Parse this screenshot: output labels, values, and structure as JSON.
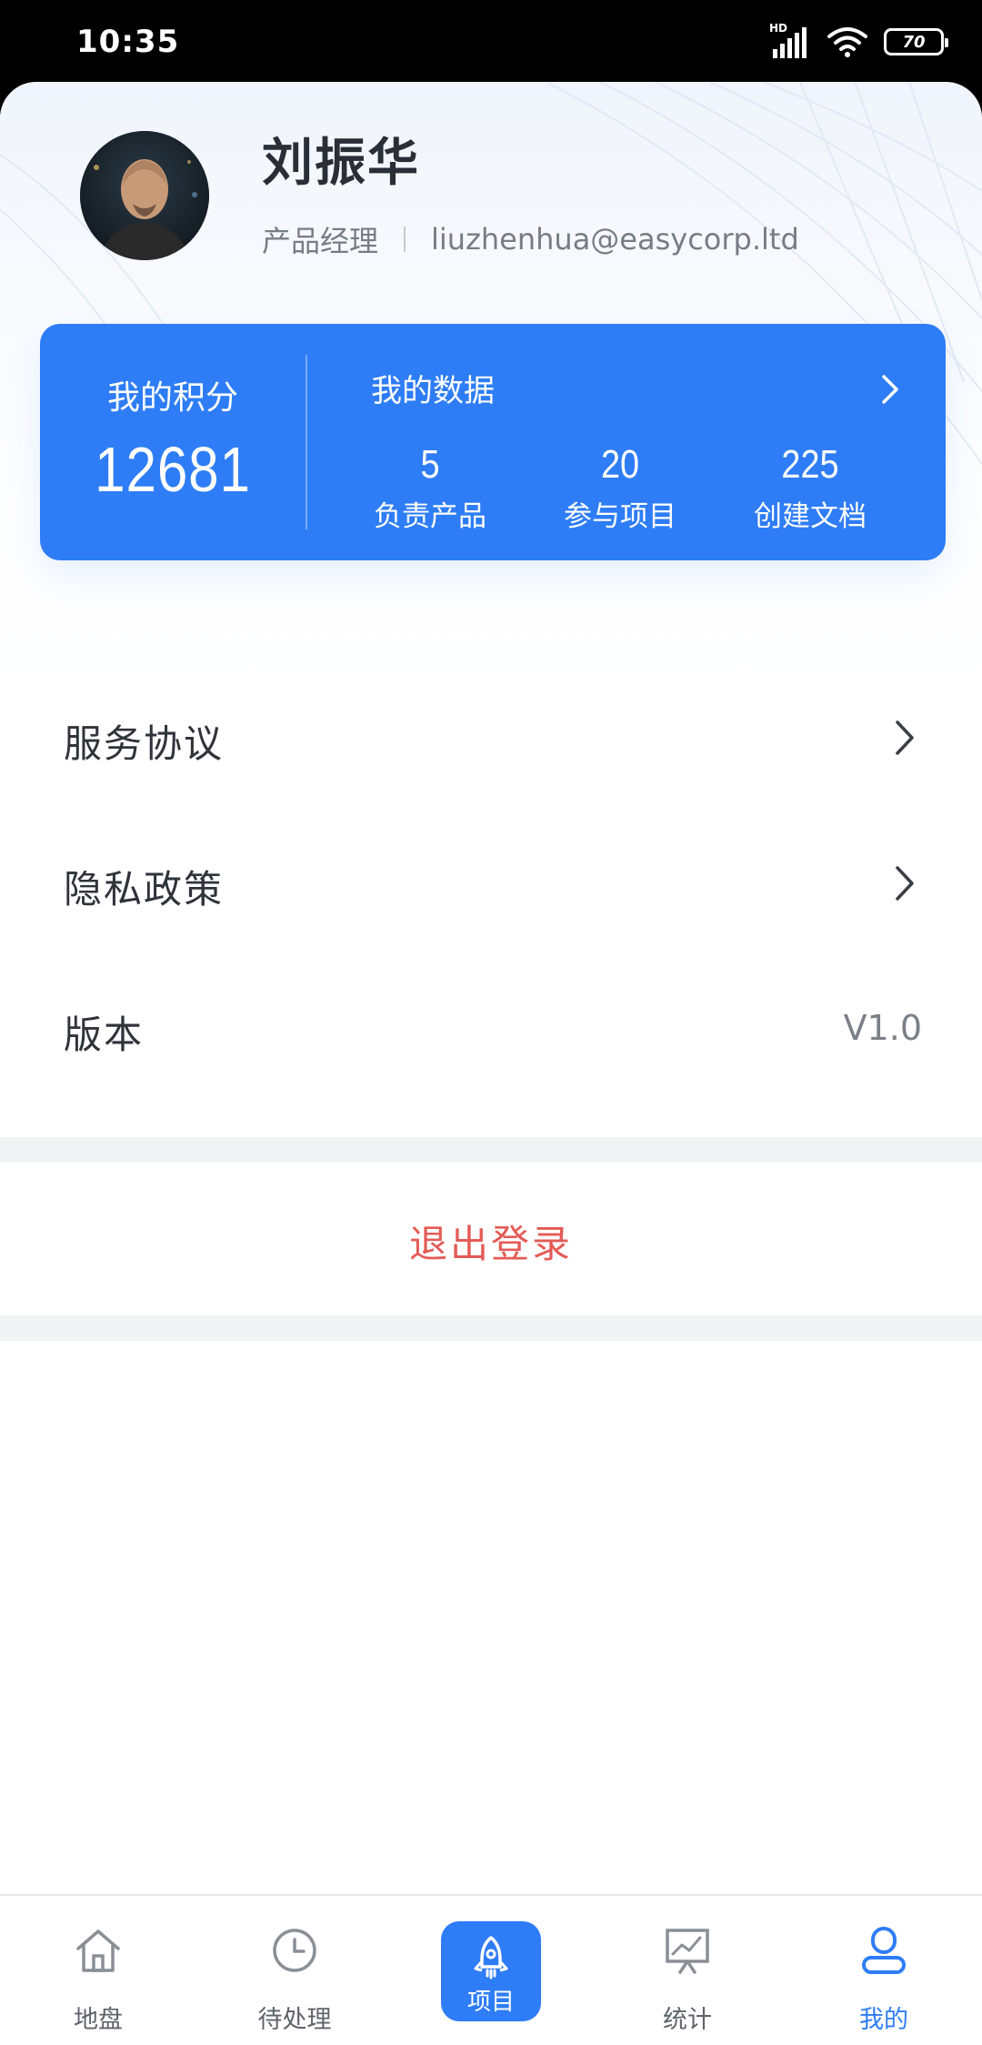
{
  "status_bar": {
    "time": "10:35",
    "network_badge": "HD",
    "battery": "70",
    "icons": [
      "signal-icon",
      "wifi-icon",
      "battery-icon"
    ]
  },
  "profile": {
    "name": "刘振华",
    "role": "产品经理",
    "email": "liuzhenhua@easycorp.ltd"
  },
  "stats_card": {
    "points_label": "我的积分",
    "points_value": "12681",
    "data_title": "我的数据",
    "items": [
      {
        "value": "5",
        "label": "负责产品"
      },
      {
        "value": "20",
        "label": "参与项目"
      },
      {
        "value": "225",
        "label": "创建文档"
      }
    ],
    "color": "#2e7df6"
  },
  "menu": {
    "items": [
      {
        "label": "服务协议"
      },
      {
        "label": "隐私政策"
      },
      {
        "label": "版本",
        "value": "V1.0"
      }
    ]
  },
  "logout": {
    "label": "退出登录",
    "color": "#e45b56"
  },
  "tab_bar": {
    "tabs": [
      {
        "label": "地盘",
        "icon": "home-icon"
      },
      {
        "label": "待处理",
        "icon": "clock-icon"
      },
      {
        "label": "项目",
        "icon": "rocket-icon"
      },
      {
        "label": "统计",
        "icon": "chart-board-icon"
      },
      {
        "label": "我的",
        "icon": "user-icon"
      }
    ],
    "active": "我的",
    "accent": "#2e7df6"
  }
}
